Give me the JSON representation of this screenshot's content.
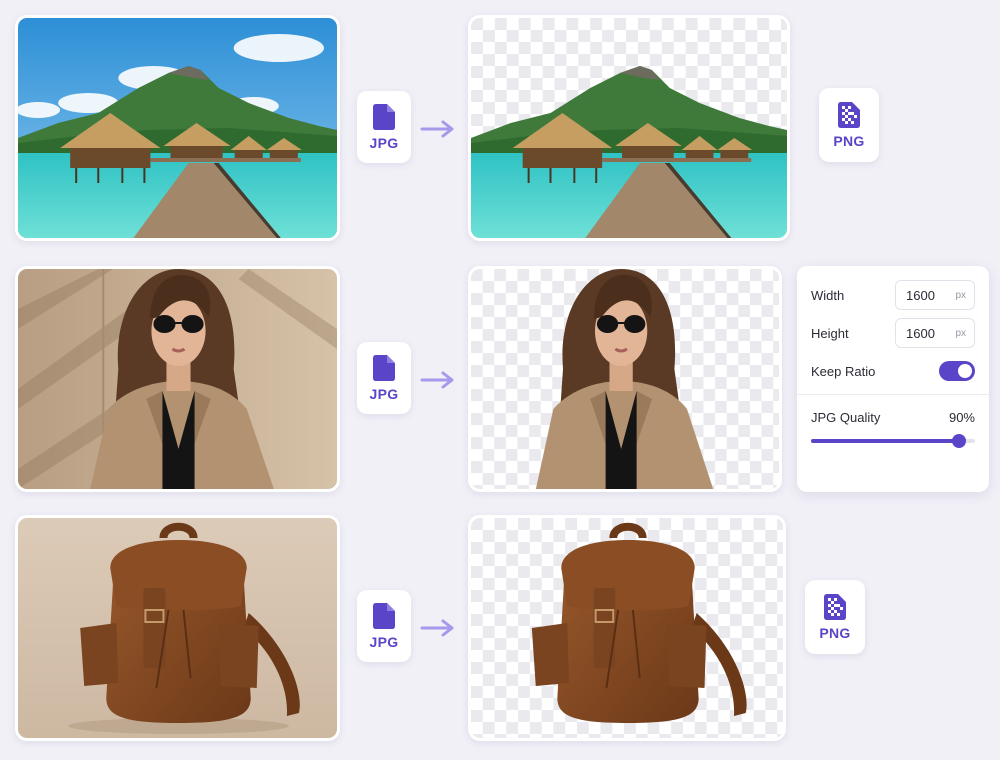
{
  "rows": [
    {
      "input_format": "JPG",
      "output_format": "PNG"
    },
    {
      "input_format": "JPG"
    },
    {
      "input_format": "JPG",
      "output_format": "PNG"
    }
  ],
  "settings": {
    "width_label": "Width",
    "width_value": "1600",
    "width_unit": "px",
    "height_label": "Height",
    "height_value": "1600",
    "height_unit": "px",
    "keep_ratio_label": "Keep Ratio",
    "keep_ratio_on": true,
    "quality_label": "JPG Quality",
    "quality_value": "90%",
    "quality_fraction": 0.9
  },
  "colors": {
    "accent": "#5a45c9",
    "arrow": "#a898ec",
    "background": "#f1f0f7"
  },
  "icons": {
    "input": "jpg-file-icon",
    "output": "png-file-icon",
    "arrow": "arrow-right-icon"
  }
}
